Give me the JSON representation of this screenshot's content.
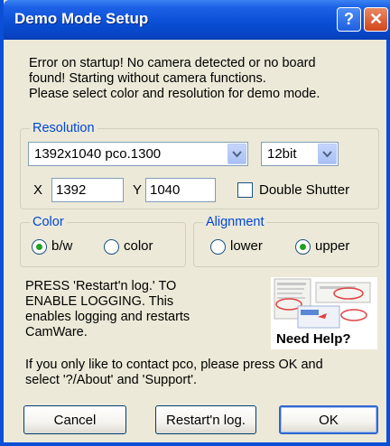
{
  "window": {
    "title": "Demo Mode Setup",
    "help_button": "?",
    "close_button": "✕"
  },
  "message": {
    "line1": "Error on startup! No camera detected or no board",
    "line2": "found! Starting without camera functions.",
    "line3": "Please select color and resolution for demo mode."
  },
  "resolution": {
    "legend": "Resolution",
    "sensor_value": "1392x1040 pco.1300",
    "bitdepth_value": "12bit",
    "x_label": "X",
    "x_value": "1392",
    "y_label": "Y",
    "y_value": "1040",
    "double_shutter_label": "Double Shutter",
    "double_shutter_checked": false
  },
  "color": {
    "legend": "Color",
    "options": [
      "b/w",
      "color"
    ],
    "selected": "b/w"
  },
  "alignment": {
    "legend": "Alignment",
    "options": [
      "lower",
      "upper"
    ],
    "selected": "upper"
  },
  "logging": {
    "line1": "PRESS 'Restart'n log.' TO",
    "line2": "ENABLE LOGGING. This",
    "line3": "enables logging and restarts",
    "line4": "CamWare."
  },
  "help_image": {
    "caption": "Need Help?"
  },
  "contact": {
    "line1": "If you only like to contact pco, please press OK and",
    "line2": "select '?/About' and 'Support'."
  },
  "buttons": {
    "cancel": "Cancel",
    "restart": "Restart'n log.",
    "ok": "OK"
  },
  "colors": {
    "titlebar": "#0a4fd6",
    "dialog_bg": "#ece9d8",
    "legend_text": "#0046d5",
    "radio_dot": "#21a121"
  },
  "icons": {
    "dropdown_arrow": "chevron-down-icon",
    "help": "question-icon",
    "close": "close-icon"
  }
}
